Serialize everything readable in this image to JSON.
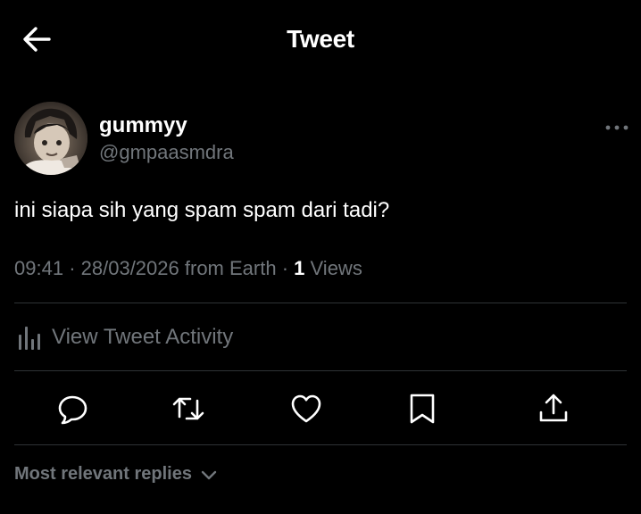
{
  "header": {
    "title": "Tweet",
    "back_icon": "arrow-left-icon"
  },
  "tweet": {
    "author": {
      "display_name": "gummyy",
      "handle": "@gmpaasmdra"
    },
    "text": "ini siapa sih yang spam spam dari tadi?",
    "time": "09:41",
    "date": "28/03/2026",
    "source": "from Earth",
    "views_count": "1",
    "views_label": "Views"
  },
  "activity": {
    "label": "View Tweet Activity",
    "icon": "analytics-icon"
  },
  "actions": [
    {
      "name": "reply",
      "icon": "reply-icon"
    },
    {
      "name": "retweet",
      "icon": "retweet-icon"
    },
    {
      "name": "like",
      "icon": "heart-icon"
    },
    {
      "name": "bookmark",
      "icon": "bookmark-icon"
    },
    {
      "name": "share",
      "icon": "share-icon"
    }
  ],
  "replies": {
    "sort_label": "Most relevant replies",
    "icon": "chevron-down-icon"
  },
  "colors": {
    "background": "#000000",
    "primary_text": "#ffffff",
    "secondary_text": "#71767b",
    "divider": "#2f3336"
  }
}
